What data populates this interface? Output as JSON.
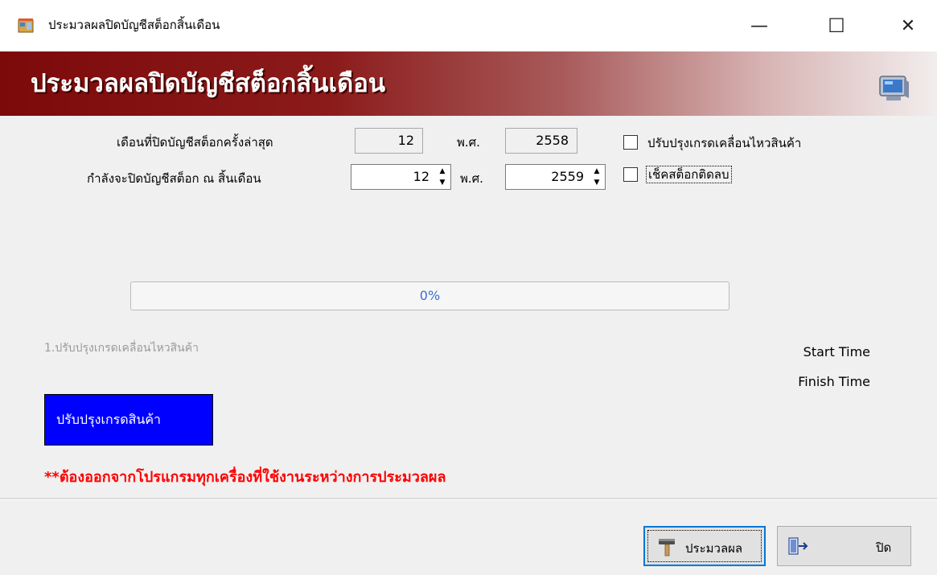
{
  "window": {
    "title": "ประมวลผลปิดบัญชีสต็อกสิ้นเดือน",
    "minimize_glyph": "—",
    "maximize_glyph": "☐",
    "close_glyph": "✕"
  },
  "banner": {
    "title": "ประมวลผลปิดบัญชีสต็อกสิ้นเดือน",
    "icon": "monitor-icon"
  },
  "form": {
    "last_closed_label": "เดือนที่ปิดบัญชีสต็อกครั้งล่าสุด",
    "last_closed_month": "12",
    "last_year_label": "พ.ศ.",
    "last_closed_year": "2558",
    "closing_label": "กำลังจะปิดบัญชีสต็อก ณ สิ้นเดือน",
    "closing_month": "12",
    "closing_year_label": "พ.ศ.",
    "closing_year": "2559",
    "update_movement_label": "ปรับปรุงเกรดเคลื่อนไหวสินค้า",
    "update_movement_checked": false,
    "check_negative_label": "เช็คสต็อกติดลบ",
    "check_negative_checked": false
  },
  "progress": {
    "value": 0,
    "text": "0%"
  },
  "status": {
    "step_text": "1.ปรับปรุงเกรดเคลื่อนไหวสินค้า",
    "start_time_label": "Start Time",
    "finish_time_label": "Finish Time"
  },
  "update_grade_button": "ปรับปรุงเกรดสินค้า",
  "warning": "**ต้องออกจากโปรแกรมทุกเครื่องที่ใช้งานระหว่างการประมวลผล",
  "footer": {
    "process_label": "ประมวลผล",
    "close_label": "ปิด"
  },
  "colors": {
    "banner_dark": "#7d0a0a",
    "blue_button": "#0000ff",
    "warning_red": "#ff0000",
    "progress_text": "#3a6fd0"
  }
}
